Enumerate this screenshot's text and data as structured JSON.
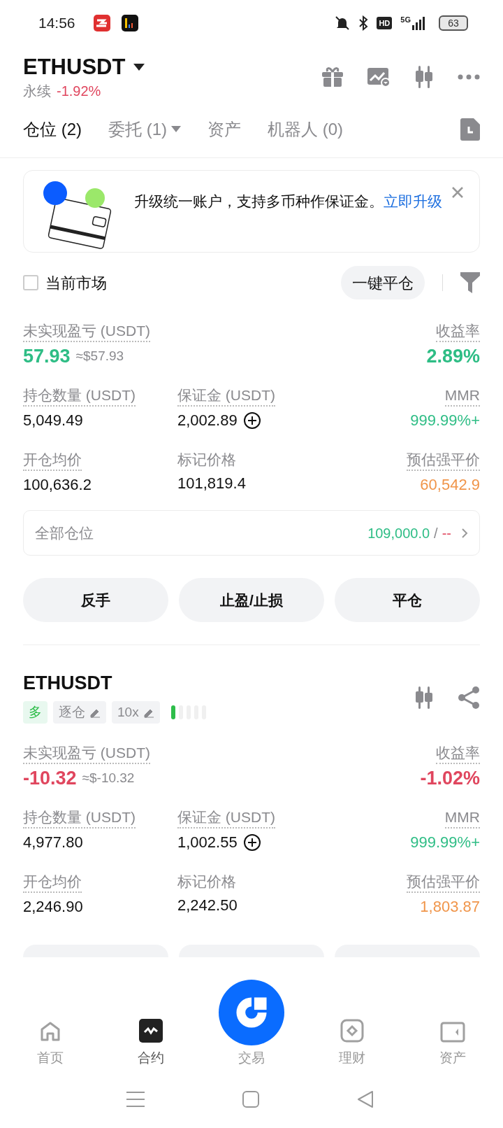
{
  "status_bar": {
    "time": "14:56",
    "network": "5G",
    "battery": "63",
    "hd": "HD"
  },
  "header": {
    "symbol": "ETHUSDT",
    "type": "永续",
    "change": "-1.92%"
  },
  "tabs": [
    {
      "label": "仓位",
      "count": "(2)",
      "selected": true,
      "dropdown": false
    },
    {
      "label": "委托",
      "count": "(1)",
      "selected": false,
      "dropdown": true
    },
    {
      "label": "资产",
      "selected": false,
      "dropdown": false
    },
    {
      "label": "机器人",
      "count": "(0)",
      "selected": false,
      "dropdown": false
    }
  ],
  "banner": {
    "text": "升级统一账户，支持多币种作保证金。",
    "link": "立即升级"
  },
  "filter": {
    "label": "当前市场",
    "checked": false,
    "close_all": "一键平仓"
  },
  "summary": {
    "metrics": [
      {
        "label": "未实现盈亏 (USDT)",
        "value": "57.93",
        "approx": "≈$57.93",
        "color": "#2ebd85",
        "big": true,
        "underlined": true,
        "add": false
      },
      {
        "label": "收益率",
        "value": "2.89%",
        "color": "#2ebd85",
        "big": true,
        "underlined": true,
        "add": false
      },
      {
        "label": "持仓数量 (USDT)",
        "value": "5,049.49",
        "color": "#111111",
        "big": false,
        "underlined": true,
        "add": false
      },
      {
        "label": "保证金 (USDT)",
        "value": "2,002.89",
        "color": "#111111",
        "big": false,
        "underlined": true,
        "add": true
      },
      {
        "label": "MMR",
        "value": "999.99%+",
        "color": "#2ebd85",
        "big": false,
        "underlined": true,
        "add": false
      },
      {
        "label": "开仓均价",
        "value": "100,636.2",
        "color": "#111111",
        "big": false,
        "underlined": true,
        "add": false
      },
      {
        "label": "标记价格",
        "value": "101,819.4",
        "color": "#111111",
        "big": false,
        "underlined": false,
        "add": false
      },
      {
        "label": "预估强平价",
        "value": "60,542.9",
        "color": "#f0954a",
        "big": false,
        "underlined": true,
        "add": false
      }
    ],
    "all_positions": {
      "label": "全部仓位",
      "value": "109,000.0",
      "separator": "/",
      "other": "--"
    },
    "actions": [
      "反手",
      "止盈/止损",
      "平仓"
    ]
  },
  "position": {
    "symbol": "ETHUSDT",
    "side": "多",
    "margin_mode": "逐仓",
    "leverage": "10x",
    "metrics": [
      {
        "label": "未实现盈亏 (USDT)",
        "value": "-10.32",
        "approx": "≈$-10.32",
        "color": "#e0465e",
        "big": true,
        "underlined": true,
        "add": false
      },
      {
        "label": "收益率",
        "value": "-1.02%",
        "color": "#e0465e",
        "big": true,
        "underlined": true,
        "add": false
      },
      {
        "label": "持仓数量 (USDT)",
        "value": "4,977.80",
        "color": "#111111",
        "big": false,
        "underlined": true,
        "add": false
      },
      {
        "label": "保证金 (USDT)",
        "value": "1,002.55",
        "color": "#111111",
        "big": false,
        "underlined": true,
        "add": true
      },
      {
        "label": "MMR",
        "value": "999.99%+",
        "color": "#2ebd85",
        "big": false,
        "underlined": true,
        "add": false
      },
      {
        "label": "开仓均价",
        "value": "2,246.90",
        "color": "#111111",
        "big": false,
        "underlined": true,
        "add": false
      },
      {
        "label": "标记价格",
        "value": "2,242.50",
        "color": "#111111",
        "big": false,
        "underlined": false,
        "add": false
      },
      {
        "label": "预估强平价",
        "value": "1,803.87",
        "color": "#f0954a",
        "big": false,
        "underlined": true,
        "add": false
      }
    ]
  },
  "bottom_nav": [
    {
      "label": "首页",
      "kind": "home",
      "selected": false
    },
    {
      "label": "合约",
      "kind": "futures",
      "selected": true
    },
    {
      "label": "交易",
      "kind": "trade",
      "selected": false
    },
    {
      "label": "理财",
      "kind": "earn",
      "selected": false
    },
    {
      "label": "资产",
      "kind": "assets",
      "selected": false
    }
  ]
}
